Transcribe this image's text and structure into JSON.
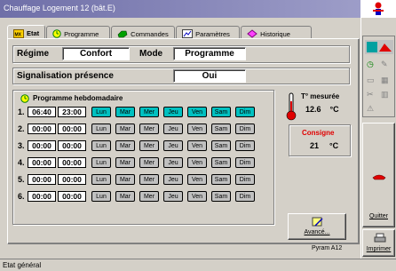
{
  "window": {
    "title": "Chauffage Logement 12 (bât.E)"
  },
  "tabs": [
    {
      "label": "Etat",
      "icon": "house-icon"
    },
    {
      "label": "Programme",
      "icon": "clock-icon"
    },
    {
      "label": "Commandes",
      "icon": "hand-icon"
    },
    {
      "label": "Paramètres",
      "icon": "chart-icon"
    },
    {
      "label": "Historique",
      "icon": "diamond-icon"
    }
  ],
  "regime": {
    "label": "Régime",
    "value": "Confort"
  },
  "mode": {
    "label": "Mode",
    "value": "Programme"
  },
  "presence": {
    "label": "Signalisation présence",
    "value": "Oui"
  },
  "programme": {
    "title": "Programme hebdomadaire",
    "days": [
      "Lun",
      "Mar",
      "Mer",
      "Jeu",
      "Ven",
      "Sam",
      "Dim"
    ],
    "rows": [
      {
        "num": "1.",
        "start": "06:40",
        "end": "23:00",
        "active": [
          true,
          true,
          true,
          true,
          true,
          true,
          true
        ]
      },
      {
        "num": "2.",
        "start": "00:00",
        "end": "00:00",
        "active": [
          false,
          false,
          false,
          false,
          false,
          false,
          false
        ]
      },
      {
        "num": "3.",
        "start": "00:00",
        "end": "00:00",
        "active": [
          false,
          false,
          false,
          false,
          false,
          false,
          false
        ]
      },
      {
        "num": "4.",
        "start": "00:00",
        "end": "00:00",
        "active": [
          false,
          false,
          false,
          false,
          false,
          false,
          false
        ]
      },
      {
        "num": "5.",
        "start": "00:00",
        "end": "00:00",
        "active": [
          false,
          false,
          false,
          false,
          false,
          false,
          false
        ]
      },
      {
        "num": "6.",
        "start": "00:00",
        "end": "00:00",
        "active": [
          false,
          false,
          false,
          false,
          false,
          false,
          false
        ]
      }
    ]
  },
  "temperature": {
    "label": "T° mesurée",
    "value": "12.6",
    "unit": "°C"
  },
  "consigne": {
    "label": "Consigne",
    "value": "21",
    "unit": "°C",
    "label_color": "#e00000"
  },
  "advanced_button": {
    "label": "Avancé..."
  },
  "model": "Pyram A12",
  "side": {
    "quit_label": "Quitter",
    "print_label": "Imprimer"
  },
  "status": {
    "text": "Etat général"
  },
  "colors": {
    "day_active": "#00c0c0",
    "day_inactive": "#c0c0c0",
    "title_bar": "#6f6fa8"
  }
}
